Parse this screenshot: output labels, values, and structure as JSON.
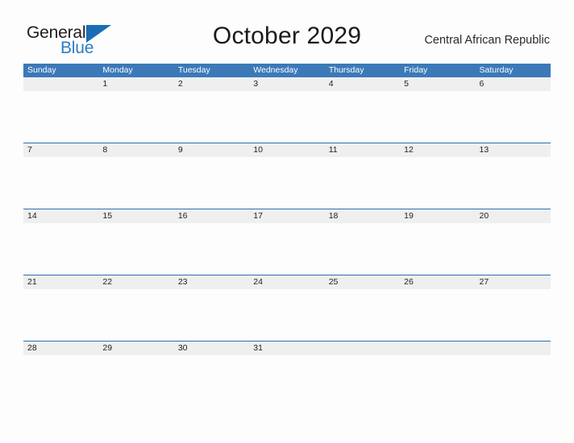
{
  "brand": {
    "name_top": "General",
    "name_bottom": "Blue",
    "triangle_color": "#1a6db5",
    "blue_color": "#2b7cc2"
  },
  "header": {
    "title": "October 2029",
    "locale": "Central African Republic"
  },
  "theme": {
    "header_blue": "#3b79b8",
    "rule_blue": "#2f6fae",
    "band_gray": "#efefef",
    "page_background": "#fdfdfd",
    "text_color": "#232323"
  },
  "calendar": {
    "weekdays": [
      "Sunday",
      "Monday",
      "Tuesday",
      "Wednesday",
      "Thursday",
      "Friday",
      "Saturday"
    ],
    "weeks": [
      {
        "days": [
          "",
          "1",
          "2",
          "3",
          "4",
          "5",
          "6"
        ]
      },
      {
        "days": [
          "7",
          "8",
          "9",
          "10",
          "11",
          "12",
          "13"
        ]
      },
      {
        "days": [
          "14",
          "15",
          "16",
          "17",
          "18",
          "19",
          "20"
        ]
      },
      {
        "days": [
          "21",
          "22",
          "23",
          "24",
          "25",
          "26",
          "27"
        ]
      },
      {
        "days": [
          "28",
          "29",
          "30",
          "31",
          "",
          "",
          ""
        ]
      }
    ]
  }
}
